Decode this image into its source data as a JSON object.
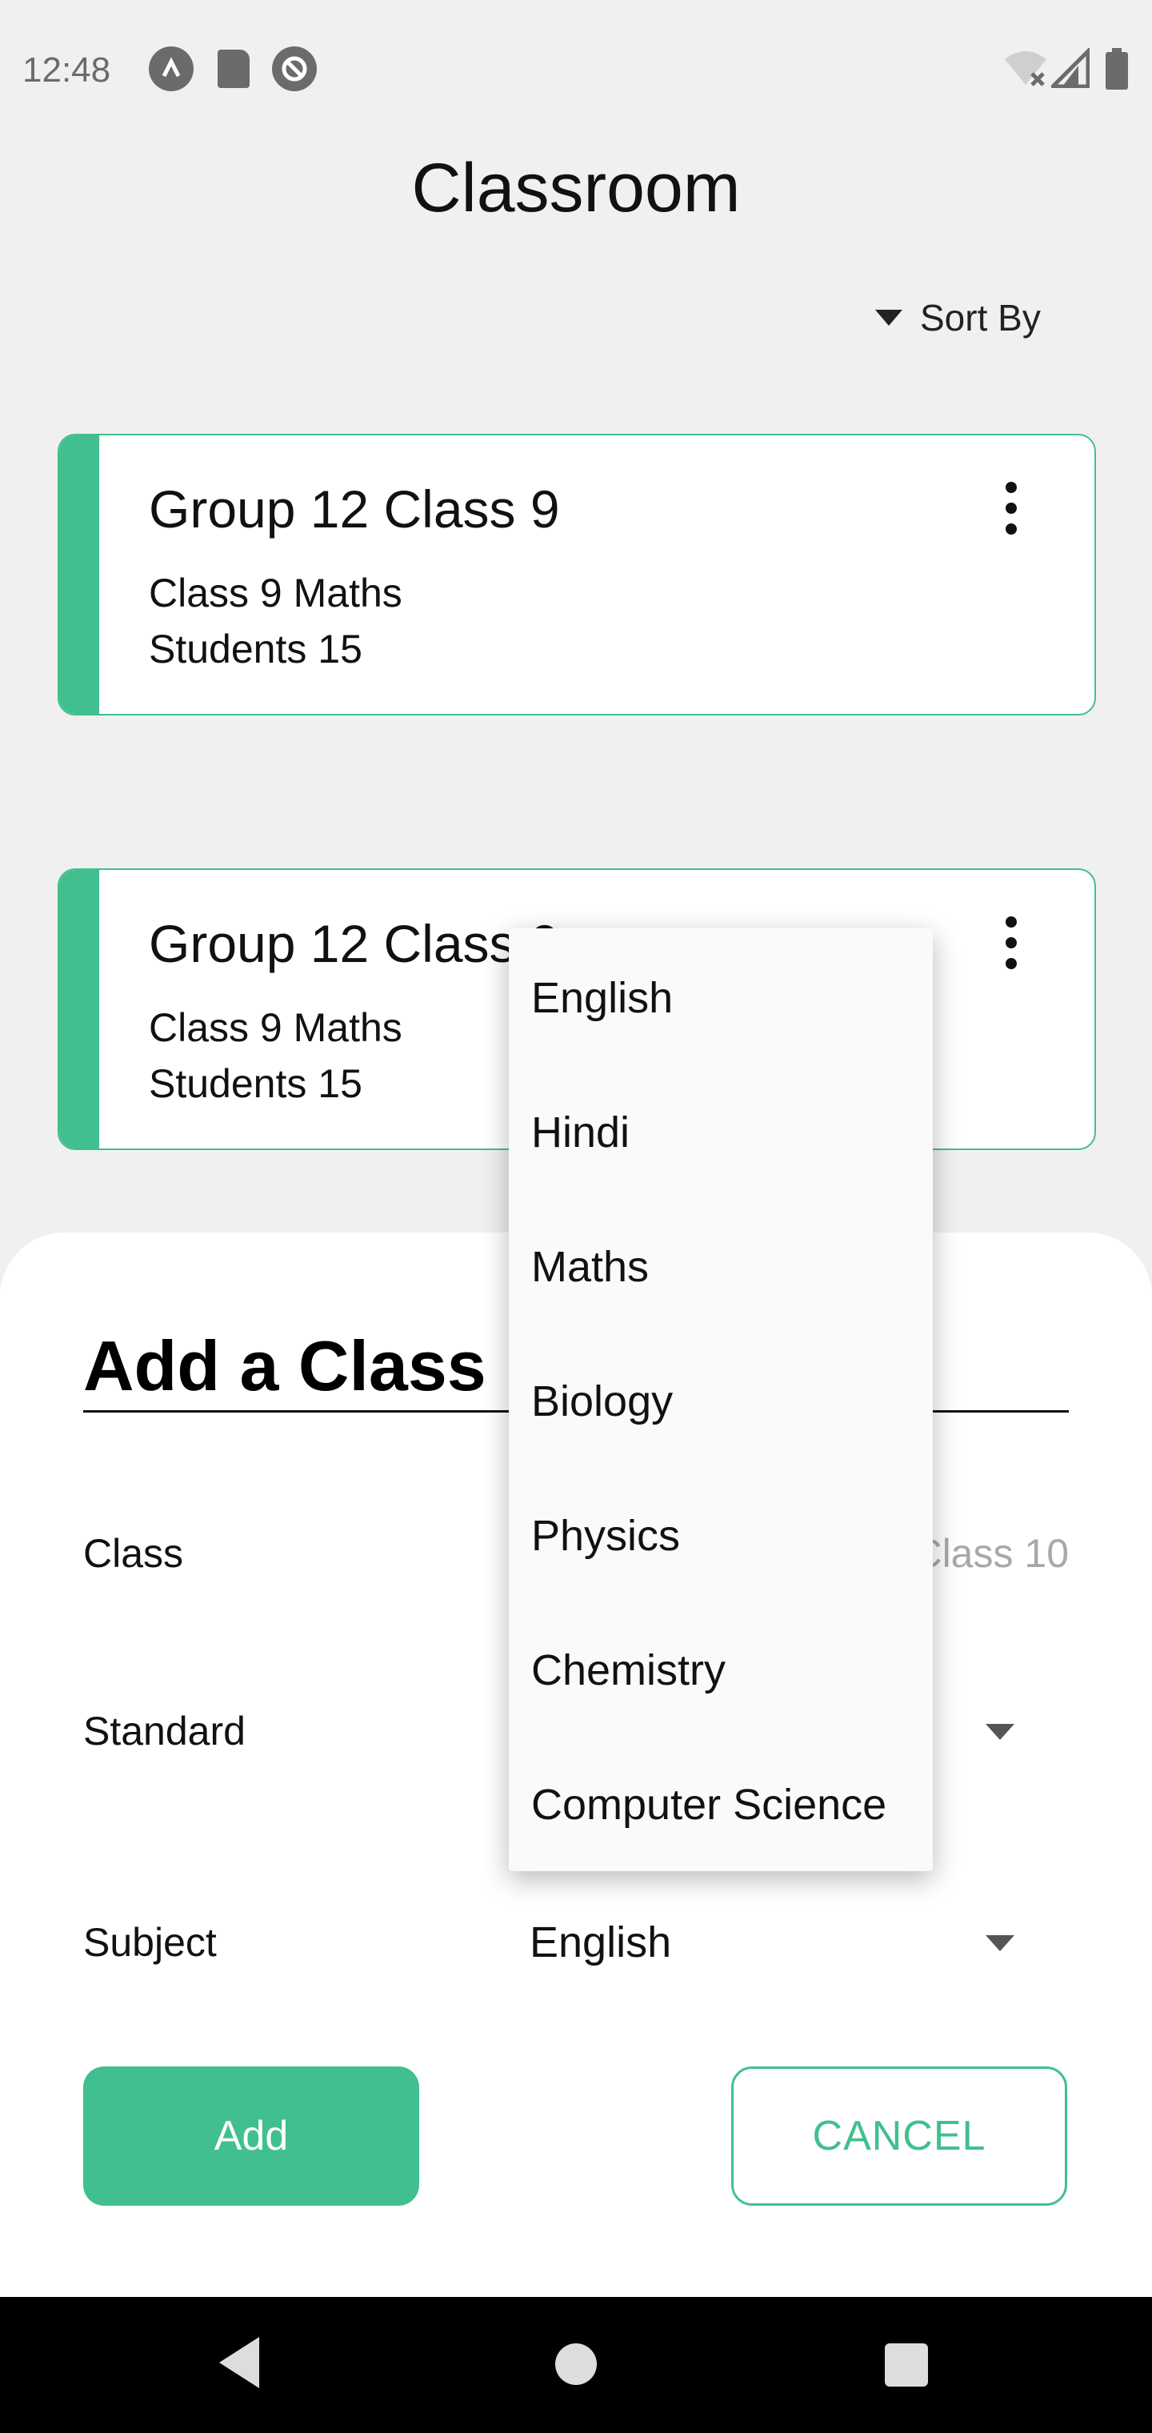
{
  "status_bar": {
    "time": "12:48",
    "icons": [
      "a-badge-icon",
      "sd-card-icon",
      "data-saver-icon",
      "wifi-off-icon",
      "cell-signal-icon",
      "battery-icon"
    ]
  },
  "header": {
    "title": "Classroom",
    "sort_label": "Sort By"
  },
  "cards": [
    {
      "title": "Group 12 Class 9",
      "subject": "Class 9 Maths",
      "students": "Students 15"
    },
    {
      "title": "Group 12 Class 9",
      "subject": "Class 9 Maths",
      "students": "Students 15"
    }
  ],
  "sheet": {
    "title": "Add a Class",
    "class_label": "Class",
    "class_placeholder": "Class 10",
    "standard_label": "Standard",
    "subject_label": "Subject",
    "subject_value": "English",
    "add_button": "Add",
    "cancel_button": "CANCEL"
  },
  "subject_menu": {
    "options": [
      "English",
      "Hindi",
      "Maths",
      "Biology",
      "Physics",
      "Chemistry",
      "Computer Science"
    ]
  },
  "colors": {
    "accent": "#42bf8e",
    "background": "#f0f0f0"
  }
}
